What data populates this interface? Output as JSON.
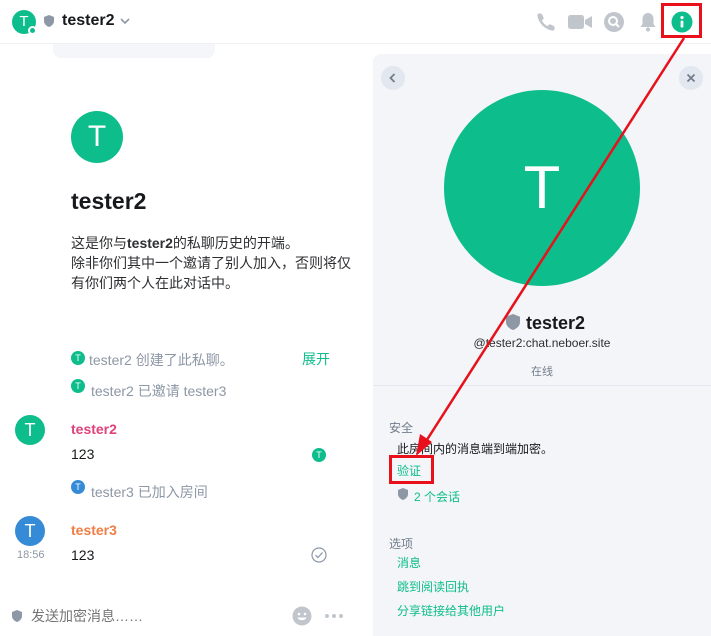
{
  "header": {
    "avatar_letter": "T",
    "room_name": "tester2"
  },
  "timeline": {
    "intro": {
      "avatar_letter": "T",
      "name": "tester2",
      "line1_prefix": "这是你与",
      "line1_name": "tester2",
      "line1_suffix": "的私聊历史的开端。",
      "line2": "除非你们其中一个邀请了别人加入，否则将仅有你们两个人在此对话中。"
    },
    "events": [
      {
        "avatar_letter": "T",
        "text": "tester2 创建了此私聊。",
        "color": "#0dbd8b"
      },
      {
        "avatar_letter": "T",
        "text": "tester2 已邀请 tester3",
        "color": "#0dbd8b"
      },
      {
        "avatar_letter": "T",
        "text": "tester3 已加入房间",
        "color": "#368bd6"
      }
    ],
    "expand_label": "展开",
    "messages": [
      {
        "avatar_letter": "T",
        "sender": "tester2",
        "body": "123",
        "sender_color": "#e0417b",
        "avatar_color": "#0dbd8b",
        "receipt_letter": "T"
      },
      {
        "avatar_letter": "T",
        "sender": "tester3",
        "body": "123",
        "sender_color": "#ee7e45",
        "avatar_color": "#368bd6",
        "timestamp": "18:56"
      }
    ]
  },
  "composer": {
    "placeholder": "发送加密消息……"
  },
  "panel": {
    "avatar_letter": "T",
    "display_name": "tester2",
    "mxid": "@tester2:chat.neboer.site",
    "presence": "在线",
    "security": {
      "title": "安全",
      "description": "此房间内的消息端到端加密。",
      "verify_label": "验证",
      "sessions_label": "2 个会话"
    },
    "options": {
      "title": "选项",
      "items": [
        "消息",
        "跳到阅读回执",
        "分享链接给其他用户"
      ]
    }
  },
  "colors": {
    "accent": "#0dbd8b",
    "annotation": "#e8101a"
  }
}
